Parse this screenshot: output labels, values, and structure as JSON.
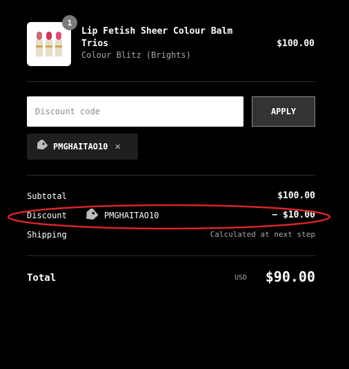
{
  "cart_item": {
    "quantity": "1",
    "title": "Lip Fetish Sheer Colour Balm Trios",
    "variant": "Colour Blitz (Brights)",
    "price": "$100.00"
  },
  "discount_form": {
    "placeholder": "Discount code",
    "apply_label": "APPLY"
  },
  "applied_discount": {
    "code": "PMGHAITAO10"
  },
  "summary": {
    "subtotal_label": "Subtotal",
    "subtotal_value": "$100.00",
    "discount_label": "Discount",
    "discount_code": "PMGHAITAO10",
    "discount_value": "− $10.00",
    "shipping_label": "Shipping",
    "shipping_value": "Calculated at next step"
  },
  "total": {
    "label": "Total",
    "currency": "USD",
    "value": "$90.00"
  },
  "colors": {
    "background": "#000000",
    "highlight_circle": "#d9262b",
    "badge": "#7a7a7a"
  }
}
